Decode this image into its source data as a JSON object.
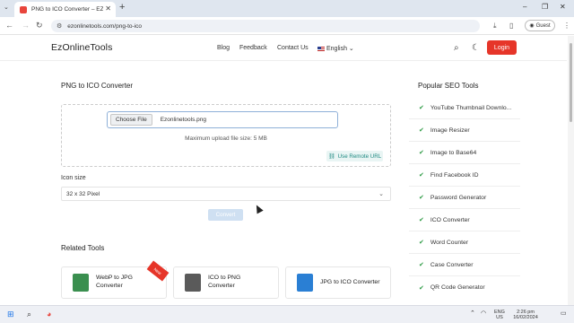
{
  "browser": {
    "tab_title": "PNG to ICO Converter – EZOnl",
    "url": "ezonlinetools.com/png-to-ico",
    "profile_label": "Guest"
  },
  "header": {
    "logo": "EzOnlineTools",
    "nav": [
      "Blog",
      "Feedback",
      "Contact Us"
    ],
    "language": "English",
    "login": "Login"
  },
  "main": {
    "title": "PNG to ICO Converter",
    "choose_file": "Choose File",
    "file_name": "Ezonlinetools.png",
    "max_size": "Maximum upload file size: 5 MB",
    "remote_url": "Use Remote URL",
    "icon_size_label": "Icon size",
    "icon_size_value": "32 x 32 Pixel",
    "convert": "Convert"
  },
  "related": {
    "title": "Related Tools",
    "cards": [
      {
        "label_1": "WebP to JPG",
        "label_2": "Converter",
        "ribbon": "New",
        "color": "#3a8f4f"
      },
      {
        "label_1": "ICO to PNG",
        "label_2": "Converter",
        "color": "#5a5a5a"
      },
      {
        "label_1": "JPG to ICO Converter",
        "label_2": "",
        "color": "#2a7fd4"
      }
    ]
  },
  "sidebar": {
    "title": "Popular SEO Tools",
    "items": [
      "YouTube Thumbnail Downlo...",
      "Image Resizer",
      "Image to Base64",
      "Find Facebook ID",
      "Password Generator",
      "ICO Converter",
      "Word Counter",
      "Case Converter",
      "QR Code Generator"
    ]
  },
  "taskbar": {
    "lang_1": "ENG",
    "lang_2": "US",
    "time": "2:26 pm",
    "date": "16/02/2024"
  },
  "colors": {
    "accent": "#e63529",
    "check": "#2e9b45",
    "remote": "#1f8a82"
  }
}
